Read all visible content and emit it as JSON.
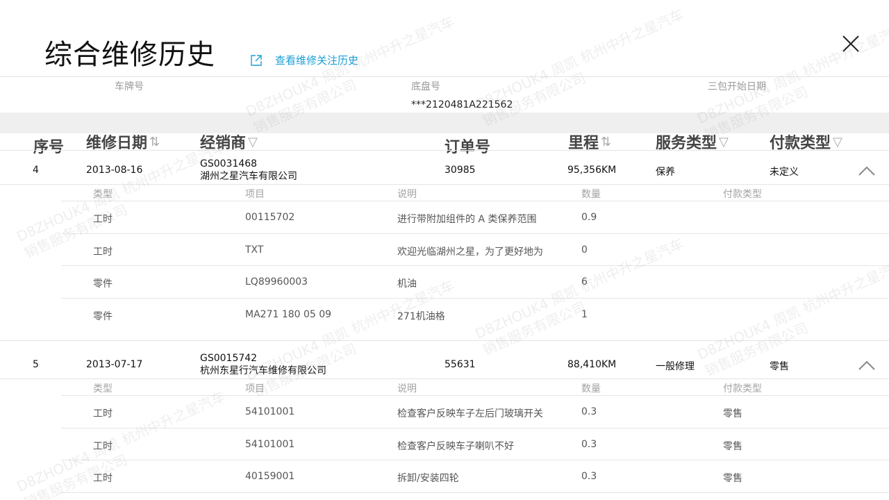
{
  "title": "综合维修历史",
  "history_link": "查看维修关注历史",
  "info": {
    "plate_label": "车牌号",
    "plate_value": "",
    "chassis_label": "底盘号",
    "chassis_value": "***2120481A221562",
    "warranty_label": "三包开始日期",
    "warranty_value": ""
  },
  "columns": {
    "index": "序号",
    "date": "维修日期",
    "dealer": "经销商",
    "order": "订单号",
    "mileage": "里程",
    "service_type": "服务类型",
    "payment_type": "付款类型"
  },
  "sub_columns": {
    "type": "类型",
    "item": "项目",
    "desc": "说明",
    "qty": "数量",
    "pay": "付款类型"
  },
  "records": [
    {
      "index": "4",
      "date": "2013-08-16",
      "dealer_code": "GS0031468",
      "dealer_name": "湖州之星汽车有限公司",
      "order": "30985",
      "mileage": "95,356KM",
      "service_type": "保养",
      "payment_type": "未定义",
      "items": [
        {
          "type": "工时",
          "item": "00115702",
          "desc": "进行带附加组件的 A 类保养范围",
          "qty": "0.9",
          "pay": ""
        },
        {
          "type": "工时",
          "item": "TXT",
          "desc": "欢迎光临湖州之星，为了更好地为",
          "qty": "0",
          "pay": ""
        },
        {
          "type": "零件",
          "item": "LQ89960003",
          "desc": "机油",
          "qty": "6",
          "pay": ""
        },
        {
          "type": "零件",
          "item": "MA271 180 05 09",
          "desc": "271机油格",
          "qty": "1",
          "pay": ""
        }
      ]
    },
    {
      "index": "5",
      "date": "2013-07-17",
      "dealer_code": "GS0015742",
      "dealer_name": "杭州东星行汽车维修有限公司",
      "order": "55631",
      "mileage": "88,410KM",
      "service_type": "一般修理",
      "payment_type": "零售",
      "items": [
        {
          "type": "工时",
          "item": "54101001",
          "desc": "检查客户反映车子左后门玻璃开关",
          "qty": "0.3",
          "pay": "零售"
        },
        {
          "type": "工时",
          "item": "54101001",
          "desc": "检查客户反映车子喇叭不好",
          "qty": "0.3",
          "pay": "零售"
        },
        {
          "type": "工时",
          "item": "40159001",
          "desc": "拆卸/安装四轮",
          "qty": "0.3",
          "pay": "零售"
        }
      ]
    }
  ],
  "watermark": {
    "line1": "D8ZHOUK4 周凯 杭州中升之星汽车",
    "line2": "销售服务有限公司"
  },
  "icons": {
    "sort": "sort-icon",
    "filter": "filter-icon",
    "close": "close-icon",
    "external": "external-link-icon",
    "collapse": "chevron-up-icon"
  },
  "colors": {
    "link": "#1a9fd6",
    "header_band": "#efefef"
  }
}
